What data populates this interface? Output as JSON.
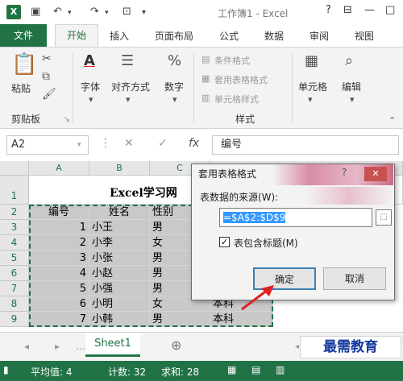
{
  "titlebar": {
    "title": "工作簿1 - Excel",
    "logo": "X",
    "help": "?"
  },
  "tabs": [
    {
      "label": "文件"
    },
    {
      "label": "开始"
    },
    {
      "label": "插入"
    },
    {
      "label": "页面布局"
    },
    {
      "label": "公式"
    },
    {
      "label": "数据"
    },
    {
      "label": "审阅"
    },
    {
      "label": "视图"
    }
  ],
  "ribbon": {
    "paste": "粘贴",
    "clipboard": "剪贴板",
    "font": "字体",
    "alignment": "对齐方式",
    "number": "数字",
    "cond_format": "条件格式",
    "table_format": "套用表格格式",
    "cell_style": "单元格样式",
    "styles": "样式",
    "cells": "单元格",
    "editing": "编辑"
  },
  "formula_bar": {
    "name_box": "A2",
    "fx": "fx",
    "value": "编号"
  },
  "columns": [
    "A",
    "B",
    "C"
  ],
  "rows": [
    "1",
    "2",
    "3",
    "4",
    "5",
    "6",
    "7",
    "8",
    "9"
  ],
  "sheet": {
    "title": "Excel学习网",
    "headers": [
      "编号",
      "姓名",
      "性别"
    ],
    "data": [
      {
        "id": "1",
        "name": "小王",
        "gender": "男"
      },
      {
        "id": "2",
        "name": "小李",
        "gender": "女"
      },
      {
        "id": "3",
        "name": "小张",
        "gender": "男"
      },
      {
        "id": "4",
        "name": "小赵",
        "gender": "男"
      },
      {
        "id": "5",
        "name": "小强",
        "gender": "男"
      },
      {
        "id": "6",
        "name": "小明",
        "gender": "女",
        "d": "本科"
      },
      {
        "id": "7",
        "name": "小韩",
        "gender": "男",
        "d": "本科"
      }
    ]
  },
  "sheet_tab": "Sheet1",
  "status": {
    "avg": "平均值: 4",
    "count": "计数: 32",
    "sum": "求和: 28"
  },
  "watermark": "最需教育",
  "dialog": {
    "title": "套用表格格式",
    "source_label": "表数据的来源(W):",
    "range": "=$A$2:$D$9",
    "has_headers": "表包含标题(M)",
    "ok": "确定",
    "cancel": "取消"
  },
  "colors": {
    "accent": "#217346",
    "arrow": "#e02020"
  }
}
